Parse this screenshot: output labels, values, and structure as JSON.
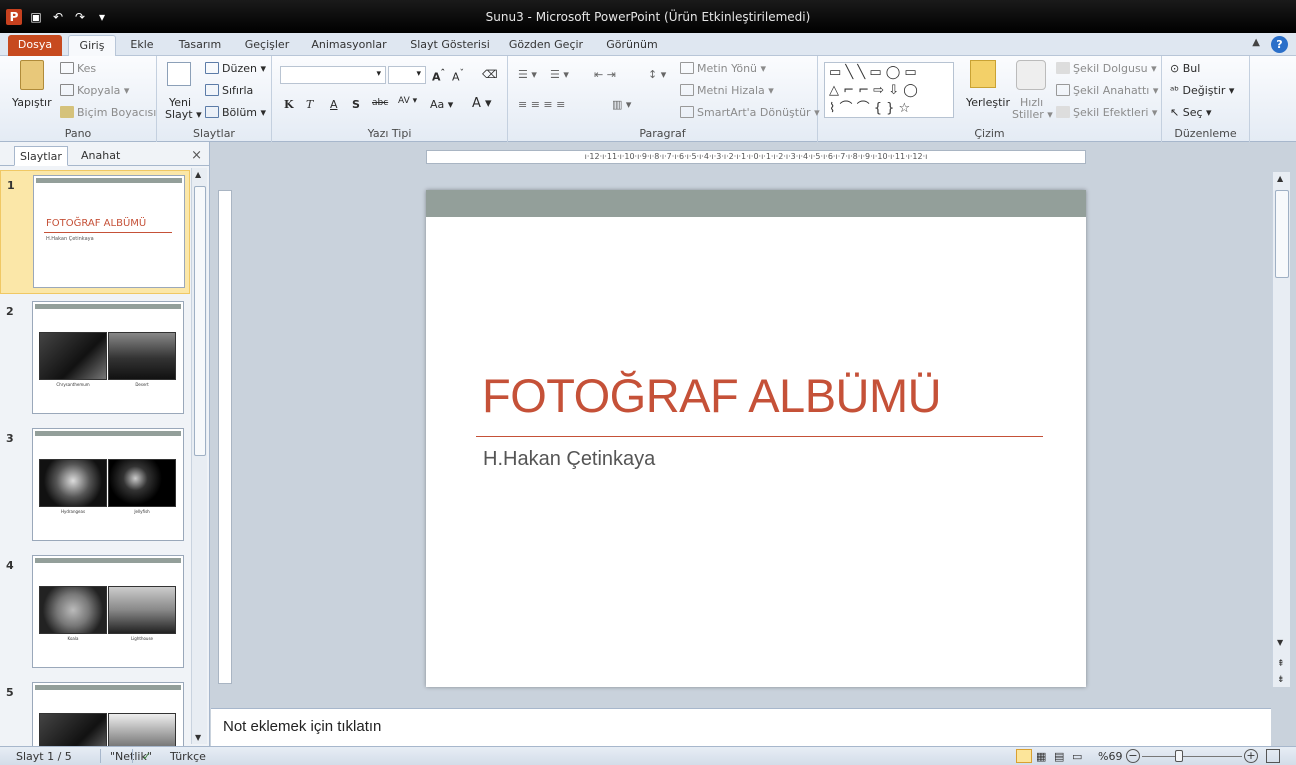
{
  "window": {
    "title": "Sunu3  -  Microsoft PowerPoint (Ürün Etkinleştirilemedi)"
  },
  "tabs": [
    "Dosya",
    "Giriş",
    "Ekle",
    "Tasarım",
    "Geçişler",
    "Animasyonlar",
    "Slayt Gösterisi",
    "Gözden Geçir",
    "Görünüm"
  ],
  "ribbon": {
    "pano": {
      "label": "Pano",
      "paste": "Yapıştır",
      "cut": "Kes",
      "copy": "Kopyala",
      "format_painter": "Biçim Boyacısı"
    },
    "slaytlar": {
      "label": "Slaytlar",
      "new_slide_line1": "Yeni",
      "new_slide_line2": "Slayt",
      "layout": "Düzen",
      "reset": "Sıfırla",
      "section": "Bölüm"
    },
    "yazi_tipi": {
      "label": "Yazı Tipi",
      "bold": "K",
      "italic": "T",
      "underline": "A",
      "shadow": "S",
      "strike": "abc",
      "spacing": "AV",
      "case": "Aa"
    },
    "paragraf": {
      "label": "Paragraf",
      "text_direction": "Metin Yönü",
      "align_text": "Metni Hizala",
      "smartart": "SmartArt'a Dönüştür"
    },
    "cizim": {
      "label": "Çizim",
      "arrange": "Yerleştir",
      "quick_styles_line1": "Hızlı",
      "quick_styles_line2": "Stiller",
      "fill": "Şekil Dolgusu",
      "outline": "Şekil Anahattı",
      "effects": "Şekil Efektleri"
    },
    "duzenleme": {
      "label": "Düzenleme",
      "find": "Bul",
      "replace": "Değiştir",
      "select": "Seç"
    }
  },
  "left_panel": {
    "tabs": [
      "Slaytlar",
      "Anahat"
    ],
    "close": "×",
    "thumbs": [
      {
        "num": "1",
        "title": "FOTOĞRAF ALBÜMÜ",
        "subtitle": "H.Hakan Çetinkaya"
      },
      {
        "num": "2",
        "cap1": "Chrysanthemum",
        "cap2": "Desert"
      },
      {
        "num": "3",
        "cap1": "Hydrangeas",
        "cap2": "Jellyfish"
      },
      {
        "num": "4",
        "cap1": "Koala",
        "cap2": "Lighthouse"
      },
      {
        "num": "5"
      }
    ]
  },
  "ruler": {
    "horizontal": "ı·12·ı·11·ı·10·ı·9·ı·8·ı·7·ı·6·ı·5·ı·4·ı·3·ı·2·ı·1·ı·0·ı·1·ı·2·ı·3·ı·4·ı·5·ı·6·ı·7·ı·8·ı·9·ı·10·ı·11·ı·12·ı"
  },
  "slide": {
    "title": "FOTOĞRAF ALBÜMÜ",
    "subtitle": "H.Hakan  Çetinkaya"
  },
  "notes": {
    "placeholder": "Not eklemek için tıklatın"
  },
  "status": {
    "slide": "Slayt 1 / 5",
    "theme": "\"Netlik\"",
    "language": "Türkçe",
    "zoom": "%69"
  },
  "colors": {
    "accent": "#c55138",
    "header_bar": "#939f9a",
    "file_tab": "#c74a1f"
  }
}
